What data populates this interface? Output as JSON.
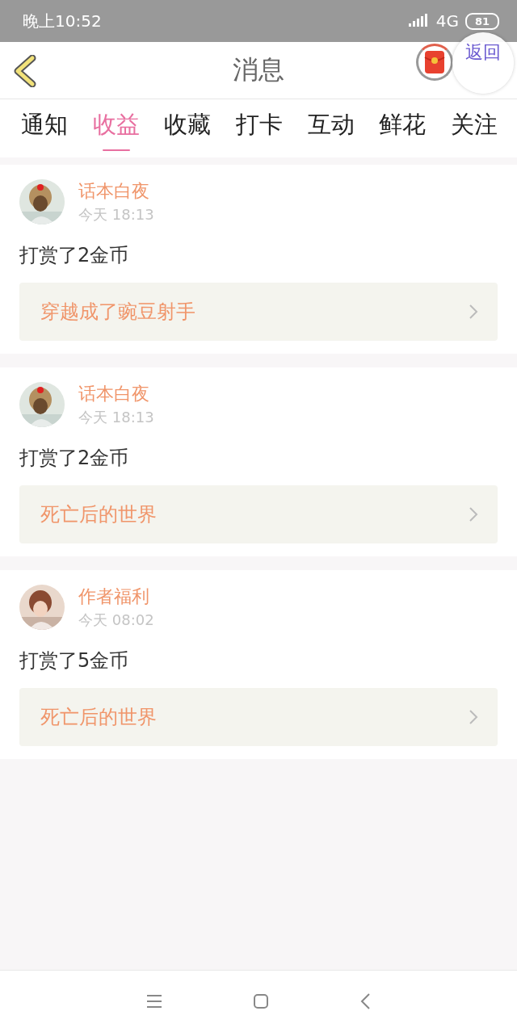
{
  "status_bar": {
    "time": "晚上10:52",
    "network": "4G",
    "battery": "81"
  },
  "header": {
    "title": "消息",
    "float_button": "返回"
  },
  "tabs": [
    {
      "label": "通知",
      "selected": false
    },
    {
      "label": "收益",
      "selected": true
    },
    {
      "label": "收藏",
      "selected": false
    },
    {
      "label": "打卡",
      "selected": false
    },
    {
      "label": "互动",
      "selected": false
    },
    {
      "label": "鲜花",
      "selected": false
    },
    {
      "label": "关注",
      "selected": false
    }
  ],
  "messages": [
    {
      "name": "话本白夜",
      "time": "今天 18:13",
      "text": "打赏了2金币",
      "book": "穿越成了豌豆射手"
    },
    {
      "name": "话本白夜",
      "time": "今天 18:13",
      "text": "打赏了2金币",
      "book": "死亡后的世界"
    },
    {
      "name": "作者福利",
      "time": "今天 08:02",
      "text": "打赏了5金币",
      "book": "死亡后的世界"
    }
  ]
}
